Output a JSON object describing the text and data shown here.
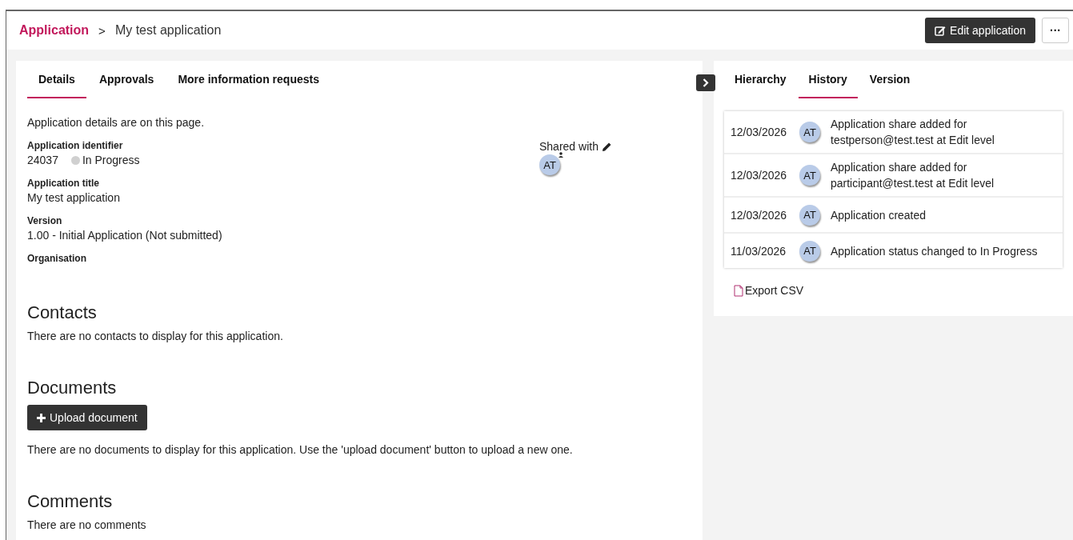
{
  "breadcrumb": {
    "parent": "Application",
    "separator": ">",
    "current": "My test application"
  },
  "header_buttons": {
    "edit": "Edit application",
    "more": "···"
  },
  "tabs": [
    {
      "label": "Details",
      "selected": true
    },
    {
      "label": "Approvals",
      "selected": false
    },
    {
      "label": "More information requests",
      "selected": false
    }
  ],
  "details": {
    "intro": "Application details are on this page.",
    "fields": [
      {
        "label": "Application identifier",
        "value": "24037",
        "status": "In Progress"
      },
      {
        "label": "Application title",
        "value": "My test application"
      },
      {
        "label": "Version",
        "value": "1.00 - Initial Application (Not submitted)"
      },
      {
        "label": "Organisation"
      }
    ],
    "shared_with": {
      "label": "Shared with",
      "avatars": [
        "AT"
      ]
    }
  },
  "sections": [
    {
      "title": "Contacts",
      "text": "There are no contacts to display for this application."
    },
    {
      "title": "Documents",
      "button": "Upload document",
      "text": "There are no documents to display for this application. Use the 'upload document' button to upload a new one."
    },
    {
      "title": "Comments",
      "text": "There are no comments"
    }
  ],
  "side_tabs": [
    {
      "label": "Hierarchy",
      "selected": false
    },
    {
      "label": "History",
      "selected": true
    },
    {
      "label": "Version",
      "selected": false
    }
  ],
  "history": [
    {
      "date": "12/03/2026",
      "avatar": "AT",
      "text": "Application share added for testperson@test.test at Edit level"
    },
    {
      "date": "12/03/2026",
      "avatar": "AT",
      "text": "Application share added for participant@test.test at Edit level"
    },
    {
      "date": "12/03/2026",
      "avatar": "AT",
      "text": "Application created"
    },
    {
      "date": "11/03/2026",
      "avatar": "AT",
      "text": "Application status changed to In Progress"
    }
  ],
  "export": "Export CSV"
}
